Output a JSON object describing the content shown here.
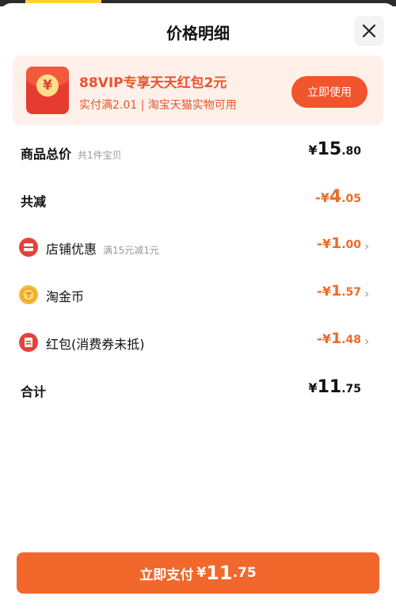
{
  "header": {
    "title": "价格明细"
  },
  "promo": {
    "icon_symbol": "¥",
    "title": "88VIP专享天天红包2元",
    "subtitle": "实付满2.01 | 淘宝天猫实物可用",
    "button": "立即使用"
  },
  "rows": {
    "total_goods": {
      "label": "商品总价",
      "note": "共1件宝贝",
      "yen": "¥",
      "int": "15",
      "dec": ".80"
    },
    "total_reduction": {
      "label": "共减",
      "yen": "-¥",
      "int": "4",
      "dec": ".05"
    },
    "store_discount": {
      "label": "店铺优惠",
      "note": "满15元减1元",
      "yen": "-¥",
      "int": "1",
      "dec": ".00"
    },
    "taojinbi": {
      "label": "淘金币",
      "yen": "-¥",
      "int": "1",
      "dec": ".57"
    },
    "red_packet": {
      "label": "红包(消费券未抵)",
      "yen": "-¥",
      "int": "1",
      "dec": ".48"
    },
    "subtotal": {
      "label": "合计",
      "yen": "¥",
      "int": "11",
      "dec": ".75"
    }
  },
  "pay": {
    "label": "立即支付",
    "yen": "¥",
    "int": "11",
    "dec": ".75"
  },
  "colors": {
    "accent": "#f2682c",
    "discount": "#ee6a2a",
    "promo_bg": "#fff0ea"
  },
  "icons": {
    "close": "close-icon",
    "store": "store-coupon-icon",
    "coin": "coin-icon",
    "packet": "red-packet-icon",
    "chevron": "chevron-right-icon"
  }
}
